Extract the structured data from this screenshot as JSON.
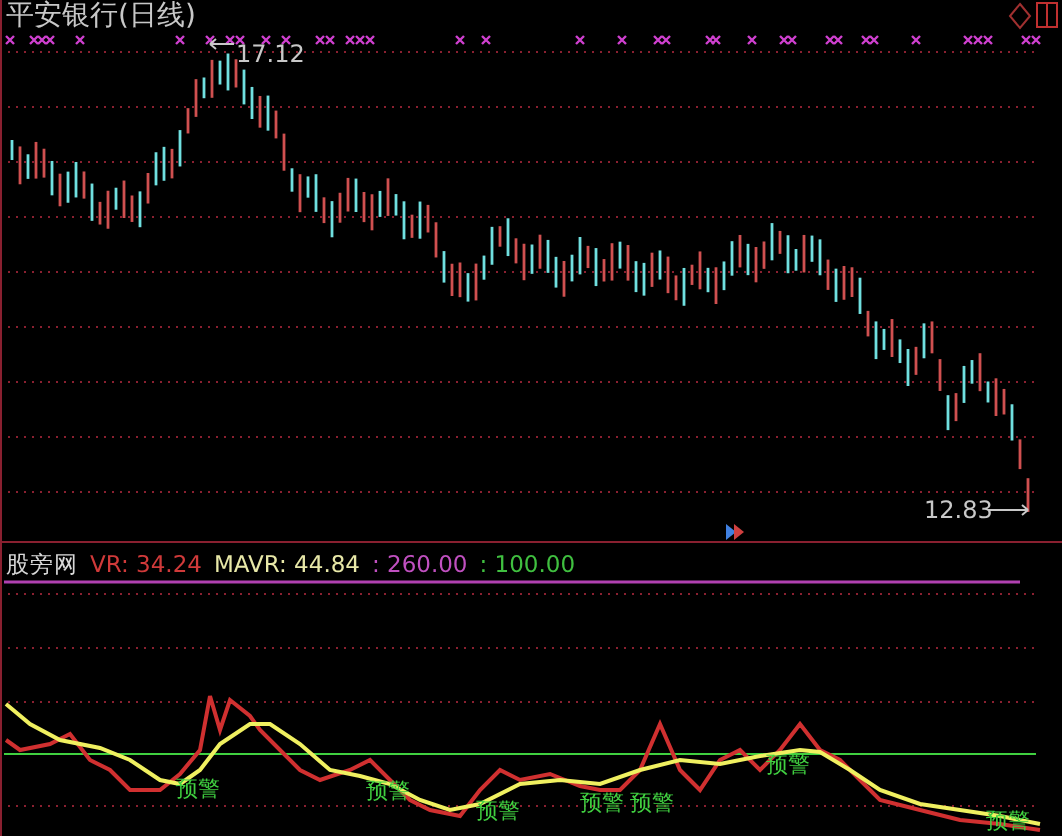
{
  "chart_title": "平安银行(日线)",
  "price_labels": [
    {
      "text": "17.12",
      "kind": "high"
    },
    {
      "text": "12.83",
      "kind": "low"
    }
  ],
  "indicator": {
    "name": "股旁网",
    "items": [
      {
        "text": "VR: 34.24",
        "color": "#d03a3a"
      },
      {
        "text": "MAVR: 44.84",
        "color": "#e8e8a8"
      },
      {
        "text": ": 260.00",
        "color": "#c050c0"
      },
      {
        "text": ": 100.00",
        "color": "#40c040"
      }
    ]
  },
  "warnings": [
    "预警",
    "预警",
    "预警",
    "预警",
    "预警",
    "预警",
    "预警"
  ]
}
